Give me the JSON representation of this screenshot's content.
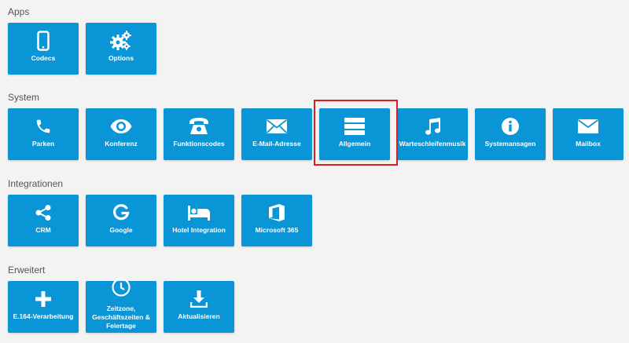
{
  "sections": {
    "apps": {
      "title": "Apps",
      "tiles": [
        {
          "label": "Codecs",
          "icon": "mobile-phone-icon"
        },
        {
          "label": "Options",
          "icon": "gears-icon"
        }
      ]
    },
    "system": {
      "title": "System",
      "tiles": [
        {
          "label": "Parken",
          "icon": "phone-handset-icon"
        },
        {
          "label": "Konferenz",
          "icon": "eye-icon"
        },
        {
          "label": "Funktionscodes",
          "icon": "desk-phone-icon"
        },
        {
          "label": "E-Mail-Adresse",
          "icon": "envelope-icon"
        },
        {
          "label": "Allgemein",
          "icon": "server-icon"
        },
        {
          "label": "Warteschleifenmusik",
          "icon": "music-note-icon"
        },
        {
          "label": "Systemansagen",
          "icon": "info-circle-icon"
        },
        {
          "label": "Mailbox",
          "icon": "envelope-icon"
        }
      ]
    },
    "integrationen": {
      "title": "Integrationen",
      "tiles": [
        {
          "label": "CRM",
          "icon": "share-nodes-icon"
        },
        {
          "label": "Google",
          "icon": "google-icon"
        },
        {
          "label": "Hotel Integration",
          "icon": "bed-icon"
        },
        {
          "label": "Microsoft 365",
          "icon": "office-icon"
        }
      ]
    },
    "erweitert": {
      "title": "Erweitert",
      "tiles": [
        {
          "label": "E.164-Verarbeitung",
          "icon": "plus-icon"
        },
        {
          "label": "Zeitzone, Geschäftszeiten & Feiertage",
          "icon": "clock-icon"
        },
        {
          "label": "Aktualisieren",
          "icon": "download-icon"
        }
      ]
    }
  },
  "colors": {
    "tile_background": "#0a96d6",
    "highlight_border": "#e01b1b",
    "page_background": "#f3f3f3"
  }
}
